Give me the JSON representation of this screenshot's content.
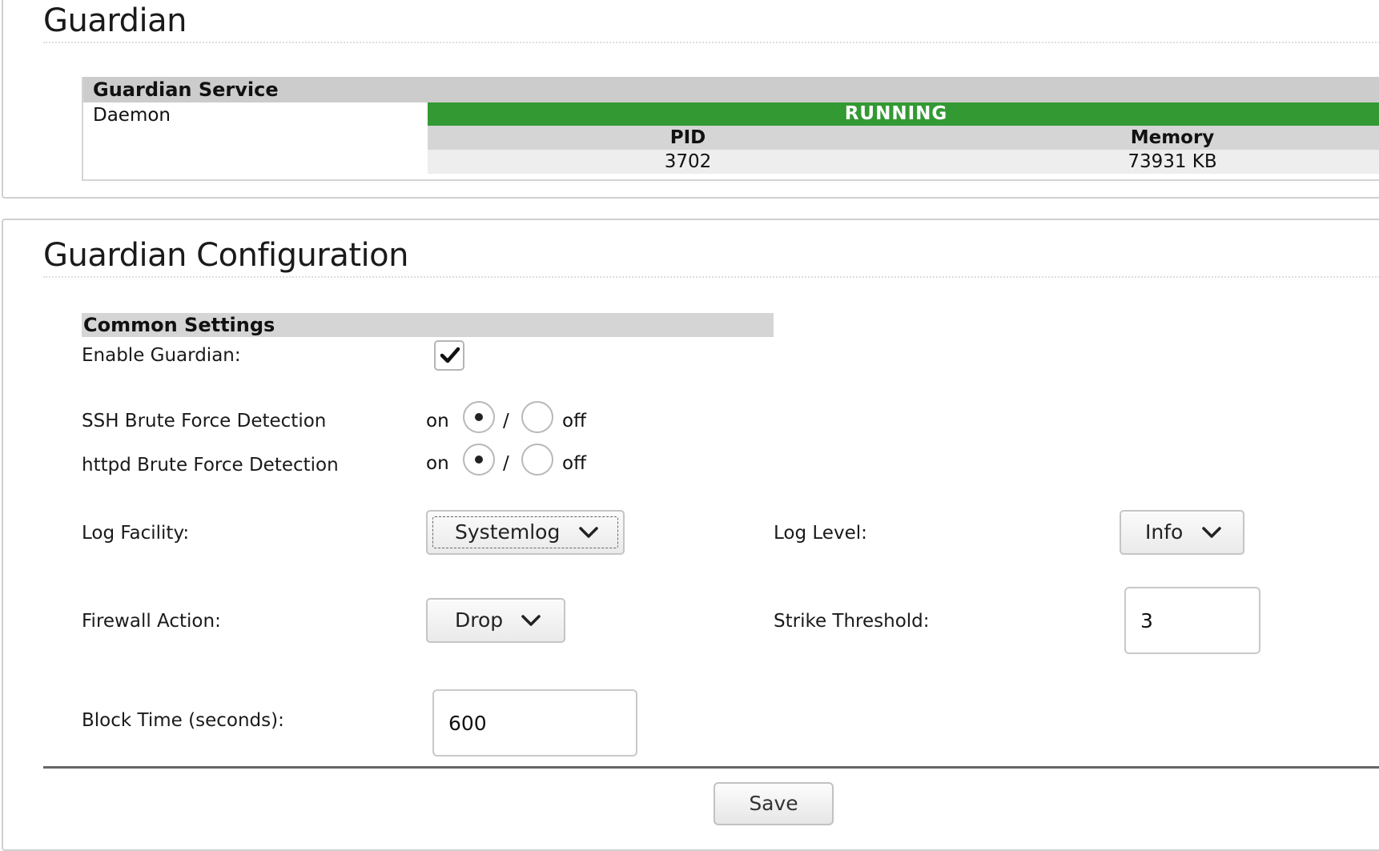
{
  "status_panel": {
    "title": "Guardian",
    "service_header": "Guardian Service",
    "daemon_label": "Daemon",
    "status": "RUNNING",
    "status_color": "#339933",
    "pid_header": "PID",
    "pid_value": "3702",
    "memory_header": "Memory",
    "memory_value": "73931 KB"
  },
  "config_panel": {
    "title": "Guardian Configuration",
    "section_header": "Common Settings",
    "enable_label": "Enable Guardian:",
    "enable_checked": true,
    "ssh_label": "SSH Brute Force Detection",
    "httpd_label": "httpd Brute Force Detection",
    "radio_on": "on",
    "radio_sep": "/",
    "radio_off": "off",
    "ssh_value": "on",
    "httpd_value": "on",
    "log_facility_label": "Log Facility:",
    "log_facility_value": "Systemlog",
    "log_level_label": "Log Level:",
    "log_level_value": "Info",
    "firewall_action_label": "Firewall Action:",
    "firewall_action_value": "Drop",
    "strike_threshold_label": "Strike Threshold:",
    "strike_threshold_value": "3",
    "block_time_label": "Block Time (seconds):",
    "block_time_value": "600",
    "save_label": "Save"
  }
}
